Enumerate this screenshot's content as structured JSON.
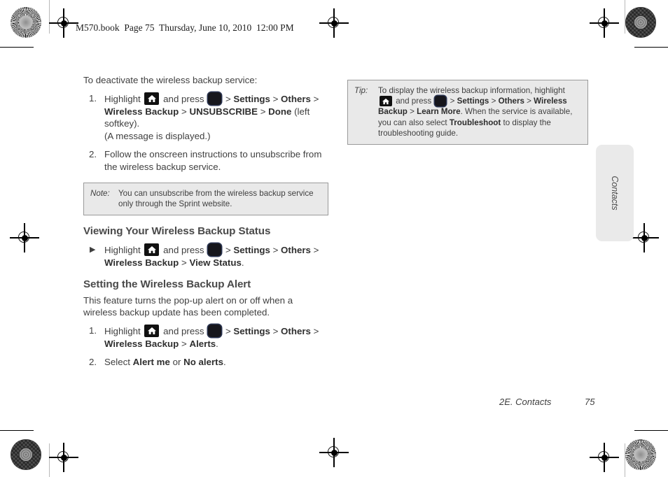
{
  "page_header": "M570.book  Page 75  Thursday, June 10, 2010  12:00 PM",
  "icons": {
    "home_key": "home-key-icon",
    "ok_key": "ok-key-icon",
    "bullet": "▶"
  },
  "left_column": {
    "intro": "To deactivate the wireless backup service:",
    "steps": [
      {
        "marker": "1.",
        "line1_pre": "Highlight",
        "line1_mid": "and press",
        "line1_post": "> ",
        "bold_a": "Settings",
        "sep_a": " > ",
        "bold_b": "Others",
        "sep_b": " >",
        "line2_bold_a": "Wireless Backup",
        "line2_sep_a": " > ",
        "line2_bold_b": "UNSUBSCRIBE",
        "line2_sep_b": " > ",
        "line2_bold_c": "Done",
        "line2_tail": " (left",
        "line3": "softkey).",
        "line4": "(A message is displayed.)"
      },
      {
        "marker": "2.",
        "text": "Follow the onscreen instructions to unsubscribe from the wireless backup service."
      }
    ],
    "note": {
      "label": "Note:",
      "text": "You can unsubscribe from the wireless backup service only through the Sprint website."
    },
    "heading_view_status": "Viewing Your Wireless Backup Status",
    "view_status_step": {
      "marker": "▶",
      "line1_pre": "Highlight",
      "line1_mid": "and press",
      "bold_a": "Settings",
      "bold_b": "Others",
      "line2_bold_a": "Wireless Backup",
      "line2_sep": " > ",
      "line2_bold_b": "View Status",
      "line2_tail": "."
    },
    "heading_alert": "Setting the Wireless Backup Alert",
    "alert_desc": "This feature turns the pop-up alert on or off when a wireless backup update has been completed.",
    "alert_steps": [
      {
        "marker": "1.",
        "line1_pre": "Highlight",
        "line1_mid": "and press",
        "bold_a": "Settings",
        "bold_b": "Others",
        "line2_bold_a": "Wireless Backup",
        "line2_sep": " > ",
        "line2_bold_b": "Alerts",
        "line2_tail": "."
      },
      {
        "marker": "2.",
        "pre": "Select ",
        "bold_a": "Alert me",
        "mid": " or ",
        "bold_b": "No alerts",
        "tail": "."
      }
    ]
  },
  "right_column": {
    "tip": {
      "label": "Tip:",
      "seg1": "To display the wireless backup information, highlight",
      "seg2": "and press",
      "bold_settings": "Settings",
      "bold_others": "Others",
      "bold_wireless_backup": "Wireless Backup",
      "bold_learn_more": "Learn More",
      "seg3": ". When the service is available, you can also select ",
      "bold_troubleshoot": "Troubleshoot",
      "seg4": " to display the troubleshooting guide."
    }
  },
  "side_tab": {
    "label": "Contacts"
  },
  "footer": {
    "chapter": "2E. Contacts",
    "page_number": "75"
  }
}
